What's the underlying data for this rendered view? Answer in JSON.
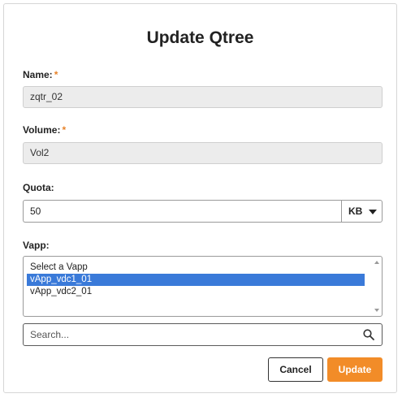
{
  "dialog": {
    "title": "Update Qtree",
    "name": {
      "label": "Name:",
      "required_mark": "*",
      "value": "zqtr_02"
    },
    "volume": {
      "label": "Volume:",
      "required_mark": "*",
      "value": "Vol2"
    },
    "quota": {
      "label": "Quota:",
      "value": "50",
      "unit": "KB"
    },
    "vapp": {
      "label": "Vapp:",
      "options": [
        "Select a Vapp",
        "vApp_vdc1_01",
        "vApp_vdc2_01"
      ],
      "selected": "vApp_vdc1_01"
    },
    "search": {
      "placeholder": "Search..."
    },
    "buttons": {
      "cancel": "Cancel",
      "update": "Update"
    },
    "colors": {
      "accent": "#f28c28",
      "required": "#e8832a",
      "selection": "#3a7ad9"
    }
  }
}
